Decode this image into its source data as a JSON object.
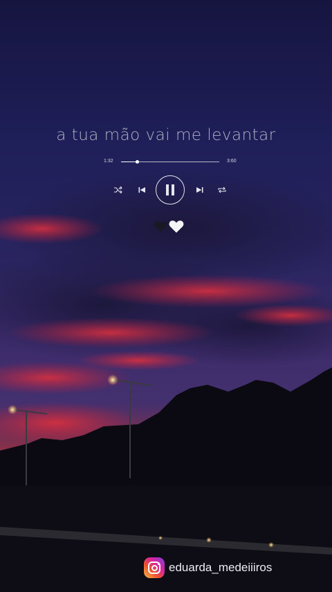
{
  "player": {
    "lyric": "a tua mão vai me levantar",
    "current_time": "1:32",
    "total_time": "3:60",
    "progress": 0.16,
    "state": "playing",
    "controls": [
      "shuffle-icon",
      "previous-icon",
      "pause-icon",
      "next-icon",
      "repeat-icon"
    ]
  },
  "emoji": [
    "black-heart-icon",
    "white-heart-icon"
  ],
  "credit": {
    "icon": "instagram-icon",
    "handle": "eduarda_medeiiiros"
  },
  "colors": {
    "sky_top": "#1a1a4a",
    "sky_red": "#c8283a",
    "text": "#e6e6ee"
  }
}
